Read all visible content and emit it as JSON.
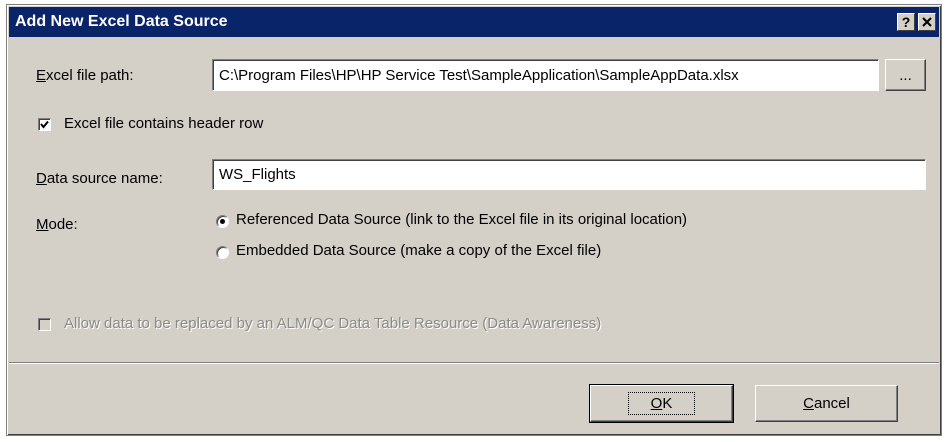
{
  "window": {
    "title": "Add New Excel Data Source",
    "help_button": "?",
    "close_button": "X"
  },
  "file_path": {
    "label_mnemonic": "E",
    "label_rest": "xcel file path:",
    "value": "C:\\Program Files\\HP\\HP Service Test\\SampleApplication\\SampleAppData.xlsx",
    "browse_label": "..."
  },
  "header_row": {
    "label": "Excel file contains header row",
    "checked": true
  },
  "data_source_name": {
    "label_mnemonic": "D",
    "label_rest": "ata source name:",
    "value": "WS_Flights"
  },
  "mode": {
    "label_mnemonic": "M",
    "label_rest": "ode:",
    "options": [
      {
        "label": "Referenced Data Source (link to the Excel file in its original location)",
        "checked": true
      },
      {
        "label": "Embedded Data Source (make a copy of the Excel file)",
        "checked": false
      }
    ]
  },
  "data_awareness": {
    "label": "Allow data to be replaced by an ALM/QC Data Table Resource (Data Awareness)",
    "checked": false,
    "enabled": false
  },
  "buttons": {
    "ok_mnemonic": "O",
    "ok_rest": "K",
    "cancel_mnemonic": "C",
    "cancel_rest": "ancel"
  }
}
